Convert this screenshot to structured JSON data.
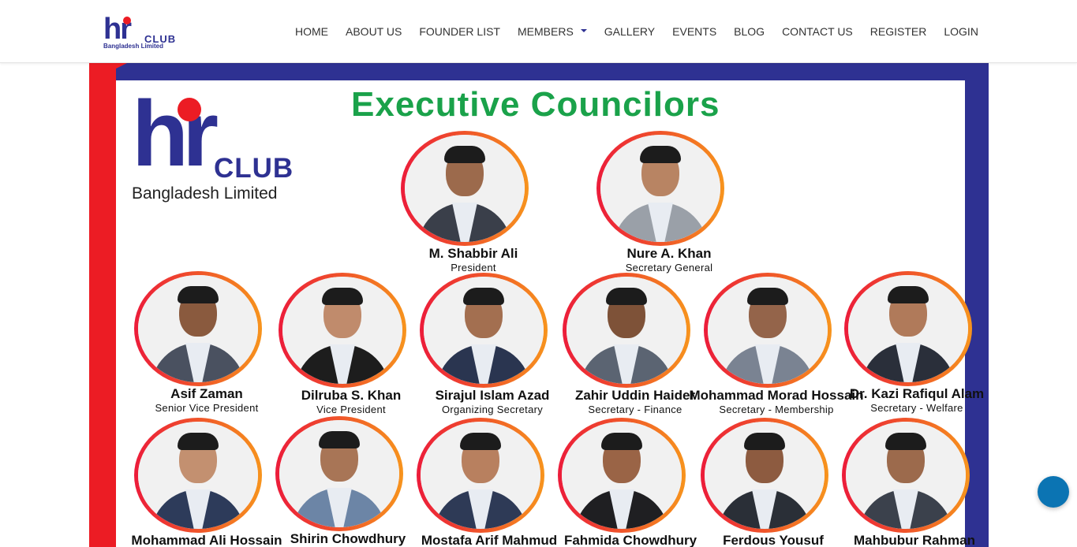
{
  "brand": {
    "logo_mark": "hr",
    "logo_word": "CLUB",
    "logo_sub": "Bangladesh Limited"
  },
  "nav": [
    {
      "label": "HOME"
    },
    {
      "label": "ABOUT US"
    },
    {
      "label": "FOUNDER LIST"
    },
    {
      "label": "MEMBERS",
      "dropdown": true
    },
    {
      "label": "GALLERY"
    },
    {
      "label": "EVENTS"
    },
    {
      "label": "BLOG"
    },
    {
      "label": "CONTACT US"
    },
    {
      "label": "REGISTER"
    },
    {
      "label": "LOGIN"
    }
  ],
  "banner": {
    "title": "Executive Councilors",
    "logo_mark": "hr",
    "logo_word": "CLUB",
    "logo_sub": "Bangladesh Limited",
    "members": [
      {
        "name": "M. Shabbir Ali",
        "role": "President"
      },
      {
        "name": "Nure A. Khan",
        "role": "Secretary General"
      },
      {
        "name": "Asif Zaman",
        "role": "Senior Vice President"
      },
      {
        "name": "Dilruba S. Khan",
        "role": "Vice President"
      },
      {
        "name": "Sirajul Islam Azad",
        "role": "Organizing Secretary"
      },
      {
        "name": "Zahir Uddin Haider",
        "role": "Secretary - Finance"
      },
      {
        "name": "Mohammad Morad Hossain",
        "role": "Secretary - Membership"
      },
      {
        "name": "Dr. Kazi Rafiqul Alam",
        "role": "Secretary - Welfare"
      },
      {
        "name": "Mohammad Ali Hossain",
        "role": ""
      },
      {
        "name": "Shirin Chowdhury",
        "role": ""
      },
      {
        "name": "Mostafa Arif Mahmud",
        "role": ""
      },
      {
        "name": "Fahmida Chowdhury",
        "role": ""
      },
      {
        "name": "Ferdous Yousuf",
        "role": ""
      },
      {
        "name": "Mahbubur Rahman",
        "role": ""
      }
    ]
  },
  "colors": {
    "brand_blue": "#2e3192",
    "brand_red": "#ec1c24",
    "title_green": "#1aa24a",
    "float_button": "#0b74b3"
  }
}
